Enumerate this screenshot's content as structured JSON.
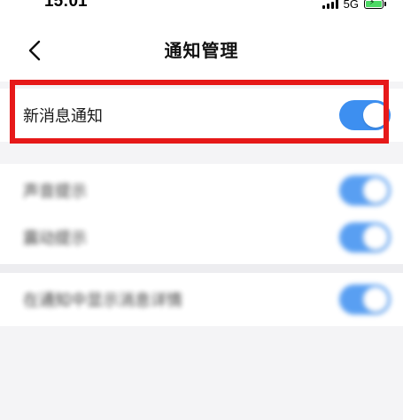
{
  "status_bar": {
    "time": "15:01",
    "network": "5G",
    "signal_icon": "signal-bars-icon",
    "battery_icon": "battery-charging-icon"
  },
  "header": {
    "back_icon": "chevron-left-icon",
    "title": "通知管理"
  },
  "settings": {
    "new_message": {
      "label": "新消息通知",
      "enabled": true
    },
    "section_caption": "",
    "sound": {
      "label": "声音提示",
      "enabled": true
    },
    "vibration": {
      "label": "震动提示",
      "enabled": true
    },
    "show_details": {
      "label": "在通知中显示消息详情",
      "enabled": true
    }
  },
  "colors": {
    "toggle_on": "#3d8ff0",
    "highlight": "#e61919",
    "background": "#f4f4f6"
  }
}
